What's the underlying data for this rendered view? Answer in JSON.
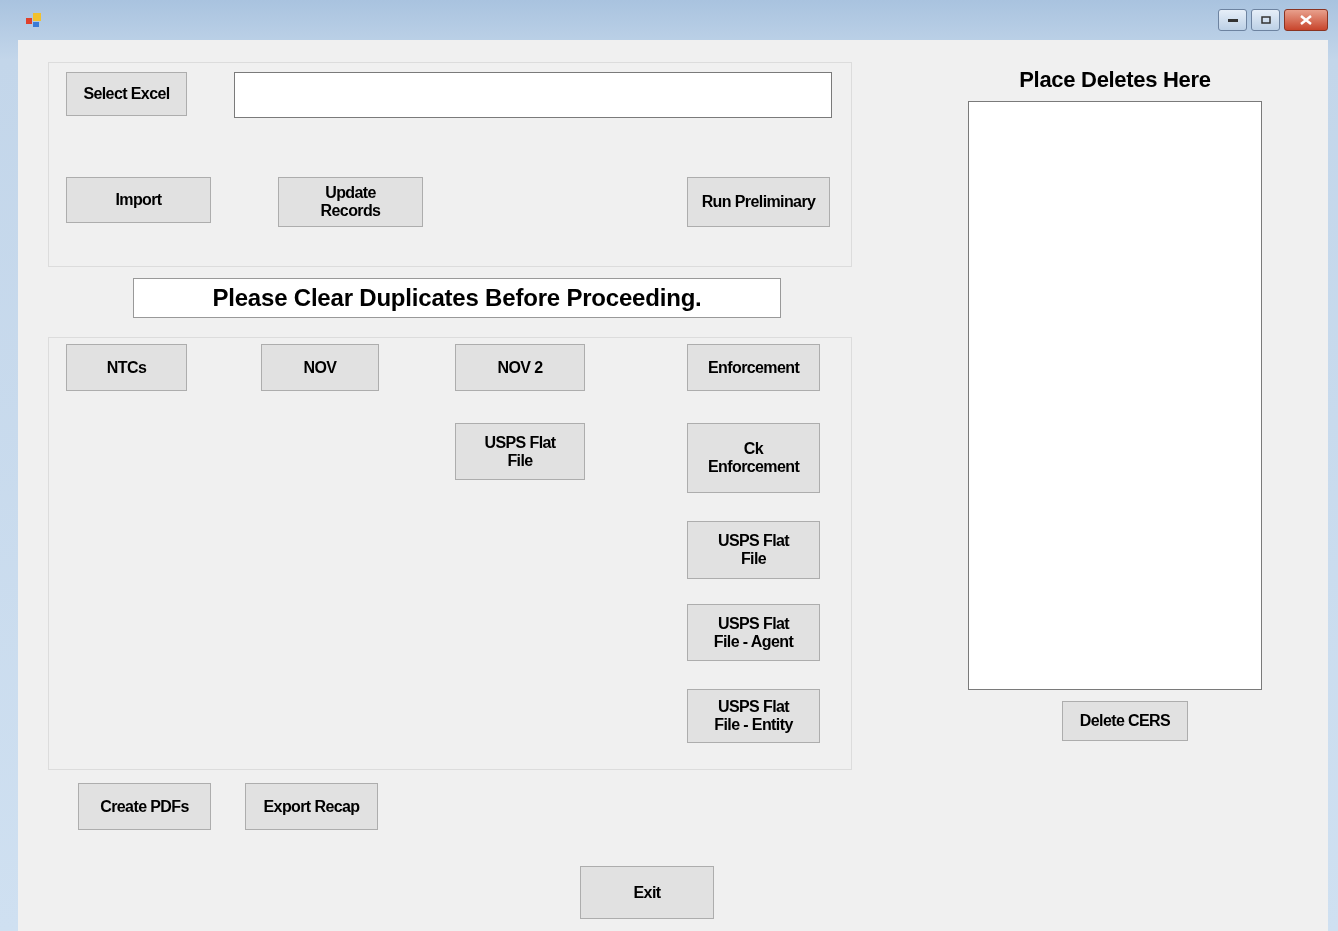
{
  "import_group": {
    "select_button": "Select Excel",
    "actions": [
      "Import",
      "Update Records",
      "Run Preliminary"
    ]
  },
  "notice": "Please Clear Duplicates Before Proceeding.",
  "letters_group": {
    "columns": [
      [
        "NTCs"
      ],
      [
        "NOV"
      ],
      [
        "NOV 2",
        "USPS Flat File"
      ],
      [
        "Enforcement",
        "Ck Enforcement",
        "USPS Flat File",
        "USPS Flat File - Agent",
        "USPS Flat File - Entity"
      ]
    ]
  },
  "bottom_buttons": [
    "Create PDFs",
    "Export Recap"
  ],
  "exit_button": "Exit",
  "deletes_panel": {
    "title": "Place Deletes Here",
    "button": "Delete CERS"
  }
}
